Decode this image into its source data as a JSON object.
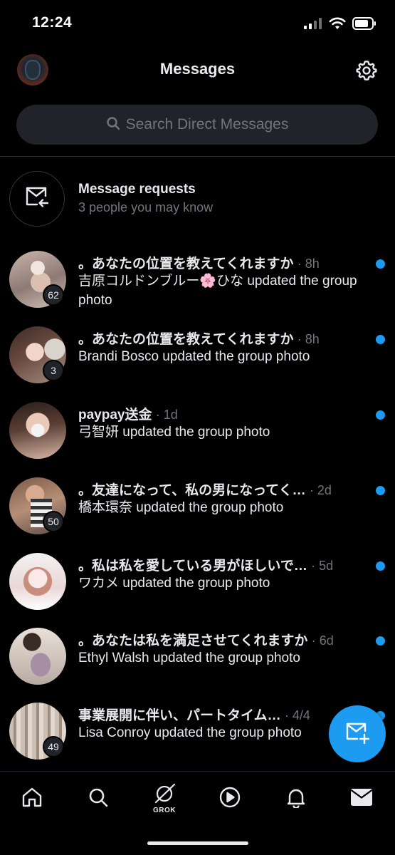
{
  "status_bar": {
    "time": "12:24"
  },
  "header": {
    "title": "Messages"
  },
  "search": {
    "placeholder": "Search Direct Messages"
  },
  "message_requests": {
    "title": "Message requests",
    "subtitle": "3 people you may know"
  },
  "conversations": [
    {
      "title": "。あなたの位置を教えてくれますか",
      "time": "· 8h",
      "preview": "吉原コルドンブルー🌸ひな updated the group photo",
      "count": "62",
      "unread": true
    },
    {
      "title": "。あなたの位置を教えてくれますか",
      "time": "· 8h",
      "preview": "Brandi Bosco updated the group photo",
      "count": "3",
      "unread": true
    },
    {
      "title": "paypay送金",
      "time": "· 1d",
      "preview": "弓智妍 updated the group photo",
      "count": "",
      "unread": true
    },
    {
      "title": "。友達になって、私の男になってく…",
      "time": "· 2d",
      "preview": "橋本環奈 updated the group photo",
      "count": "50",
      "unread": true
    },
    {
      "title": "。私は私を愛している男がほしいで…",
      "time": "· 5d",
      "preview": "ワカメ updated the group photo",
      "count": "",
      "unread": true
    },
    {
      "title": "。あなたは私を満足させてくれますか",
      "time": "· 6d",
      "preview": "Ethyl Walsh updated the group photo",
      "count": "",
      "unread": true
    },
    {
      "title": "事業展開に伴い、パートタイム…",
      "time": "· 4/4",
      "preview": "Lisa Conroy updated the group photo",
      "count": "49",
      "unread": true
    }
  ],
  "tabbar": {
    "grok_label": "GROK"
  },
  "colors": {
    "accent": "#1d9bf0",
    "background": "#000000",
    "muted": "#71767b",
    "text": "#e7e9ea"
  },
  "icons": [
    "signal-icon",
    "wifi-icon",
    "battery-icon",
    "gear-icon",
    "search-icon",
    "envelope-arrow-icon",
    "compose-message-icon",
    "home-icon",
    "grok-icon",
    "play-icon",
    "bell-icon",
    "mail-icon"
  ]
}
